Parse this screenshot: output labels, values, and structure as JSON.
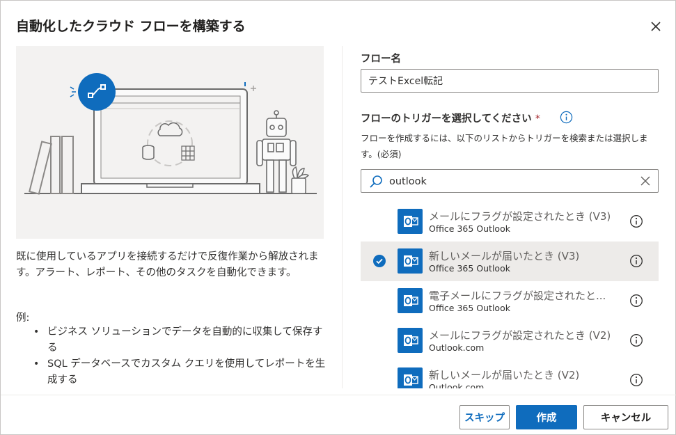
{
  "dialog": {
    "title": "自動化したクラウド フローを構築する",
    "accent_color": "#0f6cbd"
  },
  "left": {
    "description": "既に使用しているアプリを接続するだけで反復作業から解放されます。アラート、レポート、その他のタスクを自動化できます。",
    "examples_label": "例:",
    "examples": [
      "ビジネス ソリューションでデータを自動的に収集して保存する",
      "SQL データベースでカスタム クエリを使用してレポートを生成する"
    ]
  },
  "form": {
    "flow_name_label": "フロー名",
    "flow_name_value": "テストExcel転記",
    "trigger_label": "フローのトリガーを選択してください",
    "required_mark": "*",
    "trigger_hint": "フローを作成するには、以下のリストからトリガーを検索または選択します。(必須)",
    "search_value": "outlook"
  },
  "triggers": [
    {
      "title": "メールにフラグが設定されたとき (V3)",
      "connector": "Office 365 Outlook",
      "selected": false
    },
    {
      "title": "新しいメールが届いたとき (V3)",
      "connector": "Office 365 Outlook",
      "selected": true
    },
    {
      "title": "電子メールにフラグが設定されたと...",
      "connector": "Office 365 Outlook",
      "selected": false
    },
    {
      "title": "メールにフラグが設定されたとき (V2)",
      "connector": "Outlook.com",
      "selected": false
    },
    {
      "title": "新しいメールが届いたとき (V2)",
      "connector": "Outlook.com",
      "selected": false
    }
  ],
  "buttons": {
    "skip": "スキップ",
    "create": "作成",
    "cancel": "キャンセル"
  }
}
